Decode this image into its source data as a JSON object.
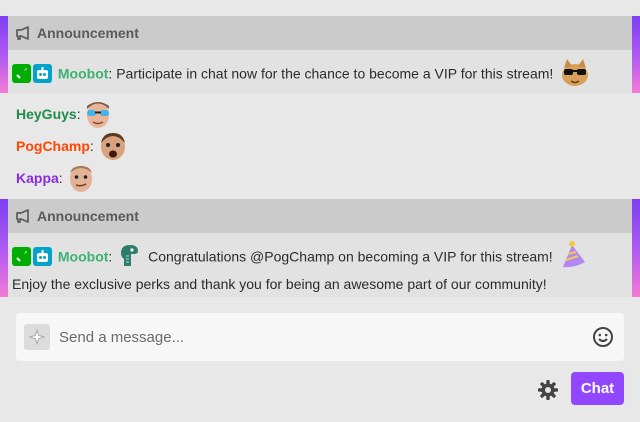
{
  "announcements": [
    {
      "header": "Announcement",
      "user": "Moobot",
      "separator": ":",
      "message": " Participate in chat now for the chance to become a VIP for this stream!",
      "emote_icon": "cool-cat-sunglasses-emote"
    },
    {
      "header": "Announcement",
      "user": "Moobot",
      "separator": ":",
      "message": " Congratulations @PogChamp on becoming a VIP for this stream!",
      "message_line2": "Enjoy the exclusive perks and thank you for being an awesome part of our community!",
      "emote_icon": "dinosaur-emote",
      "emote_icon_2": "party-hat-emote"
    }
  ],
  "chat_messages": [
    {
      "user": "HeyGuys",
      "separator": ":",
      "color": "#1f8b4c",
      "emote": "heyguys-emote"
    },
    {
      "user": "PogChamp",
      "separator": ":",
      "color": "#ff4500",
      "emote": "pogchamp-emote"
    },
    {
      "user": "Kappa",
      "separator": ":",
      "color": "#8a2be2",
      "emote": "kappa-emote"
    }
  ],
  "input": {
    "placeholder": "Send a message..."
  },
  "chat_button": "Chat",
  "colors": {
    "accent": "#9147ff",
    "moobot": "#3cb371",
    "announcement_gradient_top": "#7b3ff2",
    "announcement_gradient_bottom": "#f57ad6"
  }
}
